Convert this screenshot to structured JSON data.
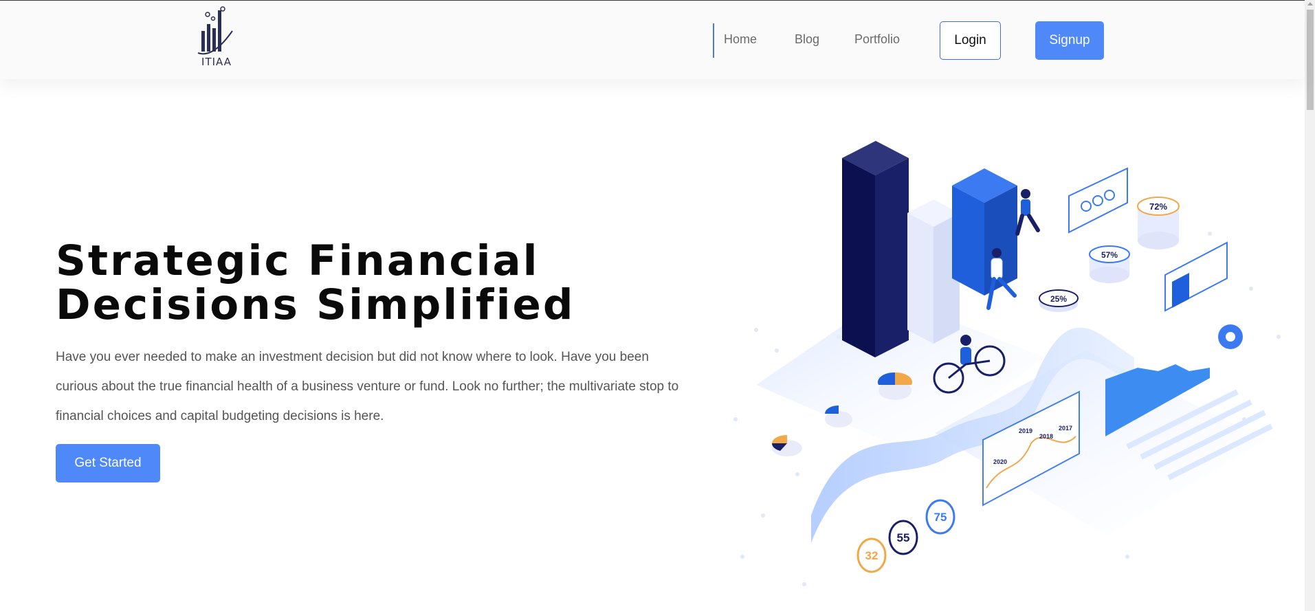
{
  "logo": {
    "text": "ITIAA"
  },
  "nav": {
    "links": [
      "Home",
      "Blog",
      "Portfolio"
    ],
    "login_label": "Login",
    "signup_label": "Signup"
  },
  "hero": {
    "title_line1": "Strategic Financial",
    "title_line2": "Decisions Simplified",
    "description": "Have you ever needed to make an investment decision but did not know where to look. Have you been curious about the true financial health of a business venture or fund. Look no further; the multivariate stop to financial choices and capital budgeting decisions is here.",
    "cta_label": "Get Started"
  },
  "illustration": {
    "badges": [
      "72%",
      "57%",
      "25%"
    ],
    "years": [
      "2020",
      "2019",
      "2018",
      "2017"
    ],
    "gauges": [
      "32",
      "55",
      "75"
    ]
  },
  "colors": {
    "accent": "#4e88f9",
    "navy": "#141a5c",
    "blue": "#1f5fdc",
    "orange": "#f0a848"
  }
}
